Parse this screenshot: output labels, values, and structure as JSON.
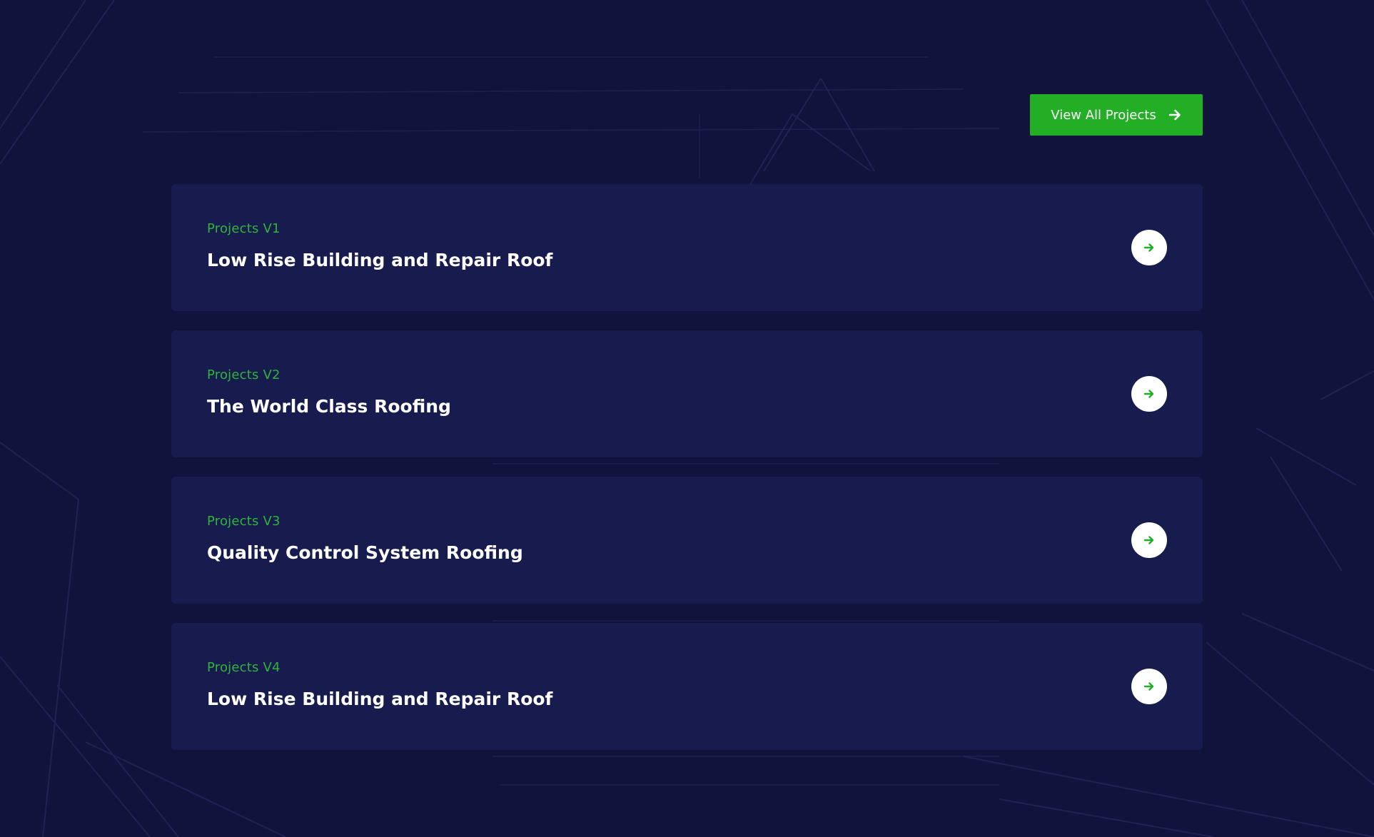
{
  "header": {
    "view_all_label": "View All Projects"
  },
  "projects": [
    {
      "tag": "Projects V1",
      "title": "Low Rise Building and Repair Roof"
    },
    {
      "tag": "Projects V2",
      "title": "The World Class Roofing"
    },
    {
      "tag": "Projects V3",
      "title": "Quality Control System Roofing"
    },
    {
      "tag": "Projects V4",
      "title": "Low Rise Building and Repair Roof"
    }
  ],
  "icons": {
    "button_icon": "arrow-right-icon",
    "card_icon": "arrow-right-icon"
  },
  "colors": {
    "background": "#11133c",
    "card": "#171b4d",
    "accent": "#22ae25",
    "tag_text": "#2fb43b",
    "title_text": "#ffffff"
  }
}
